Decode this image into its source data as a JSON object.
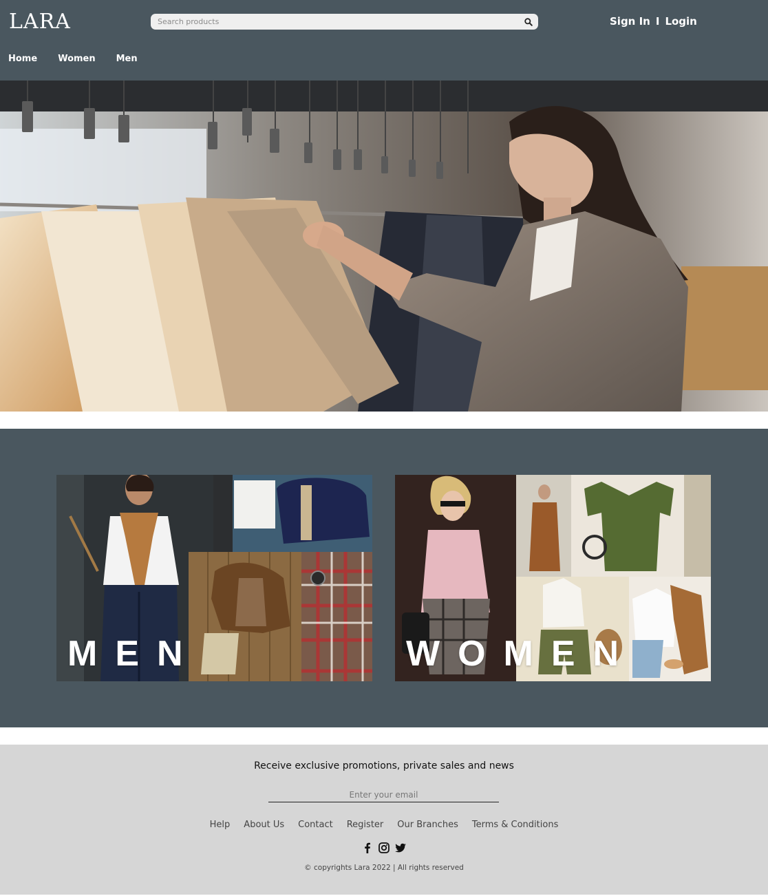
{
  "header": {
    "logo": "LARA",
    "search": {
      "placeholder": "Search products",
      "icon": "search-icon"
    },
    "auth": {
      "sign_in": "Sign In",
      "separator": "I",
      "login": "Login"
    },
    "nav": [
      {
        "label": "Home"
      },
      {
        "label": "Women"
      },
      {
        "label": "Men"
      }
    ],
    "bg_color": "#4a575f"
  },
  "hero": {
    "image": "Woman browsing shirts on a clothing rack in a store"
  },
  "categories": [
    {
      "label": "MEN",
      "image": "Collage of men's fashion: model in white polo, brown jacket flat-lay, plaid shirt, duffel bag"
    },
    {
      "label": "WOMEN",
      "image": "Collage of women's fashion: blonde woman in pink coat, green tee, white top, shorts"
    }
  ],
  "footer": {
    "promo_text": "Receive exclusive promotions, private sales and news",
    "email_placeholder": "Enter your email",
    "links": [
      "Help",
      "About Us",
      "Contact",
      "Register",
      "Our Branches",
      "Terms & Conditions"
    ],
    "social_icons": [
      "facebook-icon",
      "instagram-icon",
      "twitter-icon"
    ],
    "copyright": "© copyrights Lara 2022 | All rights reserved",
    "bg_color": "#d6d6d6"
  }
}
